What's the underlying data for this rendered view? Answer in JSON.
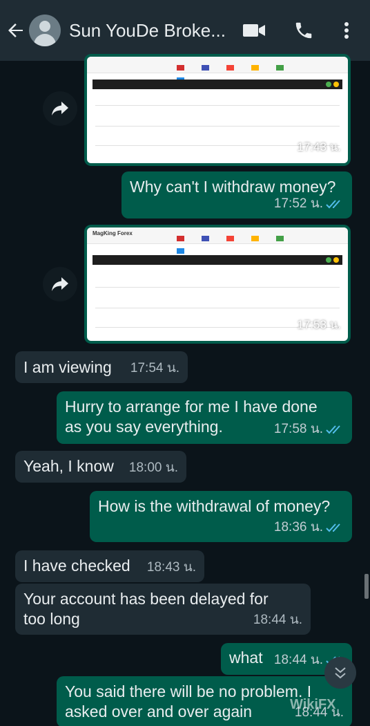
{
  "header": {
    "contact_name": "Sun YouDe Broke...",
    "back_icon": "back-arrow-icon",
    "video_icon": "video-call-icon",
    "call_icon": "phone-icon",
    "menu_icon": "more-vert-icon"
  },
  "colors": {
    "header_bg": "#1f2c34",
    "chat_bg": "#0b141a",
    "outgoing_bubble": "#005c4b",
    "incoming_bubble": "#1f2c34",
    "read_ticks": "#53bdeb"
  },
  "images": [
    {
      "time": "17:43 น.",
      "brand": ""
    },
    {
      "time": "17:53 น.",
      "brand": "MagKing Forex"
    }
  ],
  "messages": [
    {
      "dir": "out",
      "text": "Why can't I withdraw money?",
      "time": "17:52 น."
    },
    {
      "dir": "in",
      "text": "I am viewing",
      "time": "17:54 น."
    },
    {
      "dir": "out",
      "line1": "Hurry to arrange for me I have done",
      "line2": "as you say everything.",
      "time": "17:58 น."
    },
    {
      "dir": "in",
      "text": "Yeah, I know",
      "time": "18:00 น."
    },
    {
      "dir": "out",
      "text": "How is the withdrawal of money?",
      "time": "18:36 น."
    },
    {
      "dir": "in",
      "text": "I have checked",
      "time": "18:43 น."
    },
    {
      "dir": "in",
      "line1": "Your account has been delayed for",
      "line2": "too long",
      "time": "18:44 น."
    },
    {
      "dir": "out",
      "text": "what",
      "time": "18:44 น."
    },
    {
      "dir": "out",
      "line1": "You said there will be no problem. I",
      "line2": "asked over and over again",
      "time": "18:44 น."
    }
  ],
  "watermark": "WikiFX"
}
